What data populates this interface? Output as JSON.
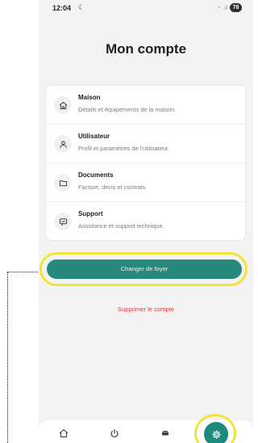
{
  "status_bar": {
    "time": "12:04",
    "moon": "☾",
    "signal": "◔ .ıl",
    "battery": "78"
  },
  "title": "Mon compte",
  "menu": [
    {
      "title": "Maison",
      "subtitle": "Détails et équipements de la maison.",
      "icon": "home-icon"
    },
    {
      "title": "Utilisateur",
      "subtitle": "Profil et paramètres de l'utilisateur.",
      "icon": "user-icon"
    },
    {
      "title": "Documents",
      "subtitle": "Facture, devis et contrats.",
      "icon": "folder-icon"
    },
    {
      "title": "Support",
      "subtitle": "Assistance et support technique.",
      "icon": "chat-icon"
    }
  ],
  "primary_button": "Changer de foyer",
  "delete_link": "Supprimer le compte",
  "tabs": [
    {
      "icon": "home-icon",
      "active": false
    },
    {
      "icon": "power-icon",
      "active": false
    },
    {
      "icon": "meter-icon",
      "active": false
    },
    {
      "icon": "gear-icon",
      "active": true
    }
  ],
  "colors": {
    "accent": "#27897b",
    "danger": "#e43838",
    "highlight": "#efe53c",
    "background": "#f3f3f4"
  }
}
